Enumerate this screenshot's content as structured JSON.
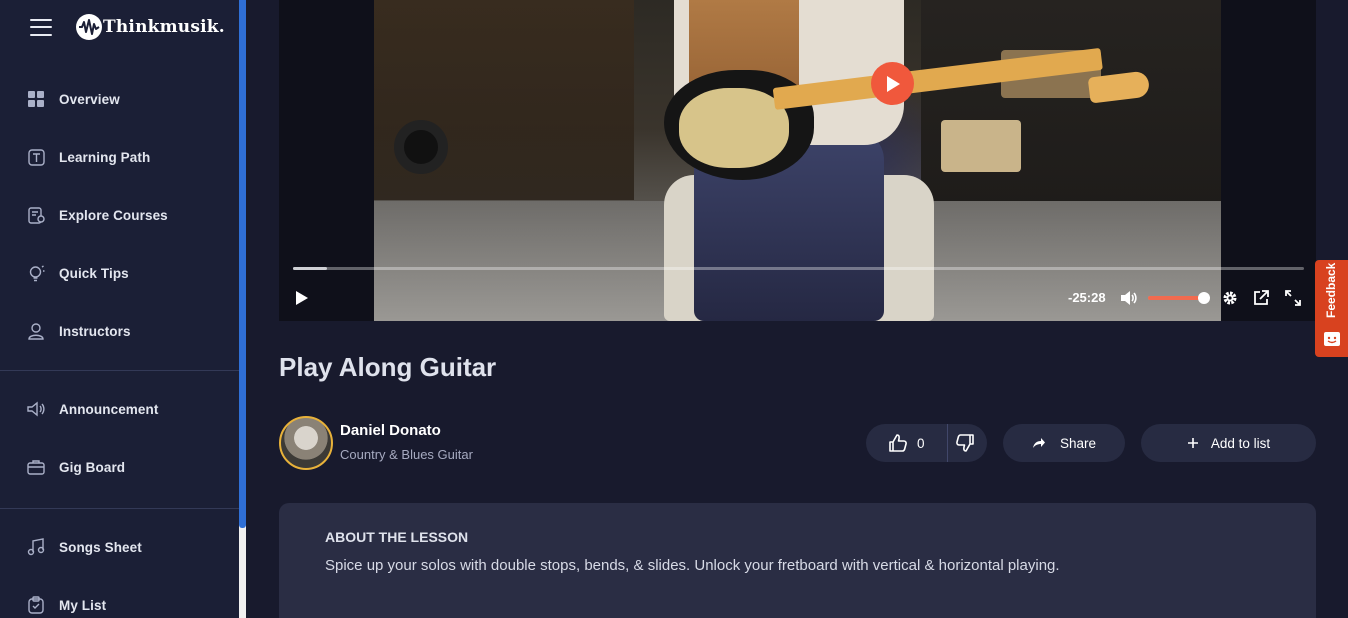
{
  "brand": {
    "name": "Thinkmusik."
  },
  "sidebar": {
    "group1": [
      {
        "label": "Overview",
        "icon": "grid-icon"
      },
      {
        "label": "Learning Path",
        "icon": "path-icon"
      },
      {
        "label": "Explore Courses",
        "icon": "courses-icon"
      },
      {
        "label": "Quick Tips",
        "icon": "lightbulb-icon"
      },
      {
        "label": "Instructors",
        "icon": "user-icon"
      }
    ],
    "group2": [
      {
        "label": "Announcement",
        "icon": "megaphone-icon"
      },
      {
        "label": "Gig Board",
        "icon": "briefcase-icon"
      }
    ],
    "group3": [
      {
        "label": "Songs Sheet",
        "icon": "music-note-icon"
      },
      {
        "label": "My List",
        "icon": "clipboard-icon"
      }
    ]
  },
  "player": {
    "time_remaining": "-25:28",
    "progress": 0.034,
    "volume": 1.0,
    "accent": "#f0583c"
  },
  "feedback": {
    "label": "Feedback"
  },
  "lesson": {
    "title": "Play Along Guitar",
    "instructor_name": "Daniel Donato",
    "instructor_subtitle": "Country & Blues Guitar",
    "like_count": "0",
    "share_label": "Share",
    "add_to_list_label": "Add to list",
    "about_heading": "ABOUT THE LESSON",
    "about_text": "Spice up your solos with double stops, bends, & slides. Unlock your fretboard with vertical & horizontal playing."
  }
}
